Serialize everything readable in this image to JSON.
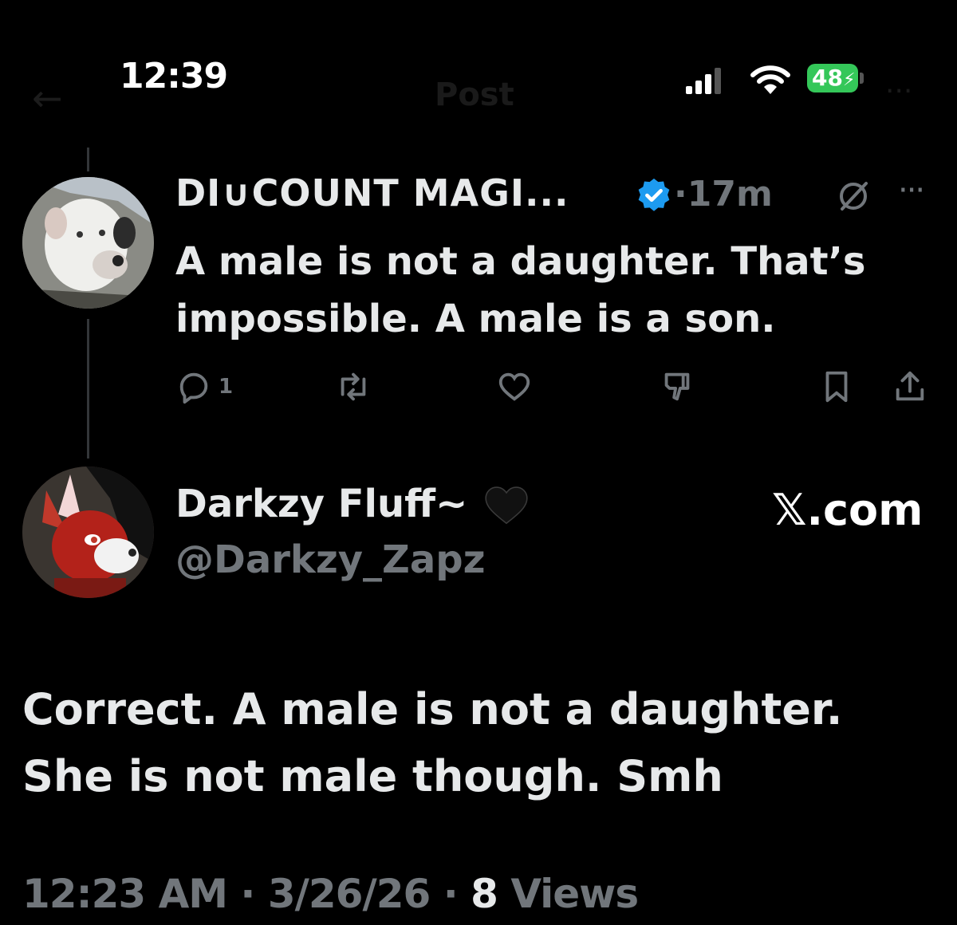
{
  "status_bar": {
    "time": "12:39",
    "battery": "48"
  },
  "nav": {
    "title": "Post",
    "back_icon": "arrow-left-icon",
    "more_icon": "more-icon"
  },
  "tweet1": {
    "display_name": "DI∪COUNT MAGI...",
    "verified": true,
    "time": "·17m",
    "text": "A male is not a daughter. That’s impossible. A male is a son.",
    "reply_count": "1",
    "actions": [
      "reply-icon",
      "retweet-icon",
      "like-icon",
      "dislike-icon",
      "bookmark-icon",
      "share-icon"
    ]
  },
  "tweet2": {
    "display_name": "Darkzy Fluff~",
    "name_emoji": "black-heart-icon",
    "handle": "@Darkzy_Zapz",
    "site": "𝕏.com",
    "text": "Correct. A male is not a daughter. She is not male though. Smh",
    "timestamp": "12:23 AM · 3/26/26 · ",
    "views_count": "8",
    "views_label": " Views"
  },
  "colors": {
    "background": "#000000",
    "text": "#e7e9ea",
    "muted": "#71767b",
    "verified": "#1d9bf0",
    "battery": "#34c759"
  }
}
